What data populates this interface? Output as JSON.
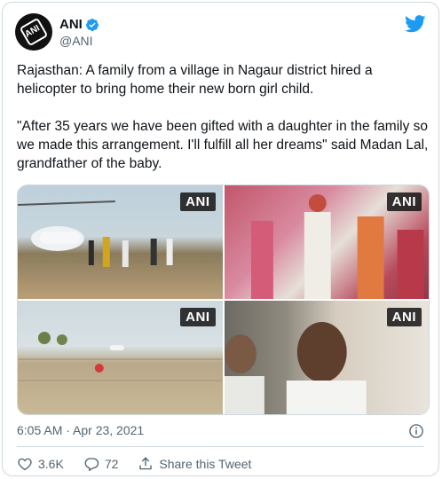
{
  "tweet": {
    "display_name": "ANI",
    "handle": "@ANI",
    "avatar_text": "ANI",
    "text": "Rajasthan: A family from a village in Nagaur district hired a helicopter to bring home their new born girl child.\n\n\"After 35 years we have been gifted with a daughter in the family so we made this arrangement. I'll fulfill all her dreams\" said Madan Lal, grandfather of the baby.",
    "media_badges": [
      "ANI",
      "ANI",
      "ANI",
      "ANI"
    ],
    "timestamp": "6:05 AM · Apr 23, 2021",
    "likes": "3.6K",
    "replies": "72",
    "share_label": "Share this Tweet"
  },
  "colors": {
    "twitter_blue": "#1d9bf0",
    "text_primary": "#0f1419",
    "text_secondary": "#536471",
    "border": "#cfd9de"
  },
  "icons": [
    "verified-badge-icon",
    "twitter-logo-icon",
    "info-icon",
    "heart-icon",
    "reply-icon",
    "share-icon"
  ]
}
